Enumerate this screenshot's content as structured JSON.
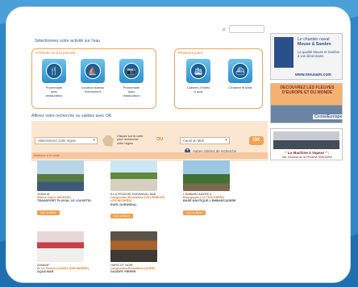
{
  "section": {
    "title": "Sélectionnez votre activité sur l'eau"
  },
  "group1": {
    "label": "A l'heure ou à la journée",
    "cards": [
      {
        "caption": "Promenade avec restauration",
        "icon": "plate-icon"
      },
      {
        "caption": "Location bateau événement",
        "icon": "boat-icon"
      },
      {
        "caption": "Promenade sans restauration",
        "icon": "camera-icon"
      }
    ]
  },
  "group2": {
    "label": "Plusieurs jours",
    "cards": [
      {
        "caption": "Cabines d'hôtes à quai",
        "icon": "cabin-boat-icon"
      },
      {
        "caption": "Croisière fluviale",
        "icon": "cruise-boat-icon"
      }
    ]
  },
  "filter": {
    "title": "Affinez votre recherche ou validez avec OK",
    "region": "Sélectionnez votre région",
    "map_hint": "Cliquez sur la carte pour rechercher votre région",
    "or": "OU",
    "canal": "Canal du Midi",
    "ok": "OK",
    "more": "Autres critères de recherche"
  },
  "results": {
    "label": "Bateaux à la carte",
    "items": [
      {
        "name": "JOSHUA",
        "location": "Rhône-Alpes (MONZIE)",
        "company": "TRANSPORT FLUVIAL LE LOUVETEL",
        "button": "Voir la fiche"
      },
      {
        "name": "A LA PENICHE DURANDAL B&B",
        "location": "Languedoc-Roussillon (VILLENEUVE LES BEZIERS)",
        "company": "EURL DURANDAL",
        "button": "Voir la fiche"
      },
      {
        "name": "L'EMBARCADERE II",
        "location": "Bourgogne (LA TRUCHERE)",
        "company": "BASE NAUTIQUE L'EMBARCADERE",
        "button": "Voir la fiche"
      },
      {
        "name": "ZAMANF",
        "location": "Ile de France (LAGNY SUR MARNE)",
        "company": "AQUA BAR"
      },
      {
        "name": "HARICOT NOIR",
        "location": "Languedoc-Roussillon (AGDE)",
        "company": "GAUDRY PIERRE"
      }
    ]
  },
  "ads": {
    "ad1": {
      "line1": "Le chantier naval",
      "line2": "Meuse & Sambre",
      "line3": "La qualité Meuse et Sambre à vos dimensions",
      "url": "www.meusam.com"
    },
    "ad2": {
      "line1": "DECOUVREZ LES FLEUVES D'EUROPE ET DU MONDE",
      "brand": "CroisiEurope"
    },
    "ad3": {
      "title": "\" La Machine à Vapeur \" :",
      "sub": "bar musical de la Péniche NIAGARA"
    }
  },
  "colors": {
    "accent": "#f2a14e",
    "link": "#2a5d94",
    "background": "#2f86c6"
  }
}
